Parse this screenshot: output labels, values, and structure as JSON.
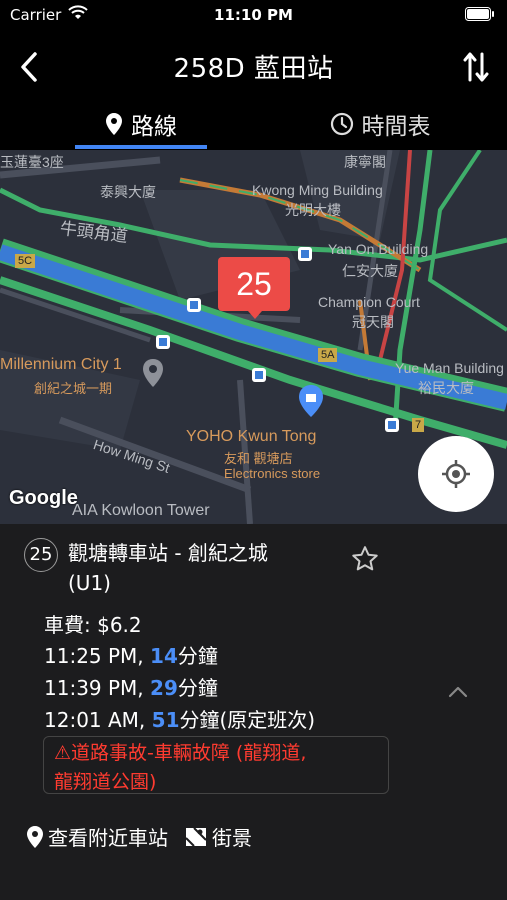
{
  "status_bar": {
    "carrier": "Carrier",
    "time": "11:10 PM"
  },
  "nav": {
    "title": "258D 藍田站",
    "back_icon": "chevron-left-icon",
    "swap_icon": "swap-direction-icon"
  },
  "tabs": [
    {
      "label": "路線",
      "icon": "map-pin-icon",
      "active": true
    },
    {
      "label": "時間表",
      "icon": "clock-icon",
      "active": false
    }
  ],
  "map": {
    "labels": [
      "玉蓮臺3座",
      "康寧閣",
      "泰興大廈",
      "Kwong Ming Building",
      "光明大樓",
      "牛頭角道",
      "Yan On Building",
      "仁安大廈",
      "5C",
      "Champion Court",
      "冠天閣",
      "5A",
      "Millennium City 1",
      "創紀之城一期",
      "Yue Man Building",
      "裕民大廈",
      "YOHO Kwun Tong",
      "友和 觀塘店",
      "Electronics store",
      "How Ming St",
      "7",
      "AIA Kowloon Tower"
    ],
    "marker_number": "25",
    "attribution": "Google",
    "route_color": "#3a7bd5"
  },
  "stop": {
    "sequence": "25",
    "name_line1": "觀塘轉車站 - 創紀之城",
    "name_line2": "(U1)",
    "fare": "車費: $6.2",
    "etas": [
      {
        "time": "11:25 PM, ",
        "minutes": "14",
        "unit": "分鐘",
        "note": ""
      },
      {
        "time": "11:39 PM, ",
        "minutes": "29",
        "unit": "分鐘",
        "note": ""
      },
      {
        "time": "12:01 AM, ",
        "minutes": "51",
        "unit": "分鐘",
        "note": "(原定班次)"
      }
    ],
    "alert_line1": "⚠道路事故-車輛故障 (龍翔道,",
    "alert_line2": "龍翔道公園)"
  },
  "actions": {
    "nearby": "查看附近車站",
    "street_view": "街景"
  }
}
